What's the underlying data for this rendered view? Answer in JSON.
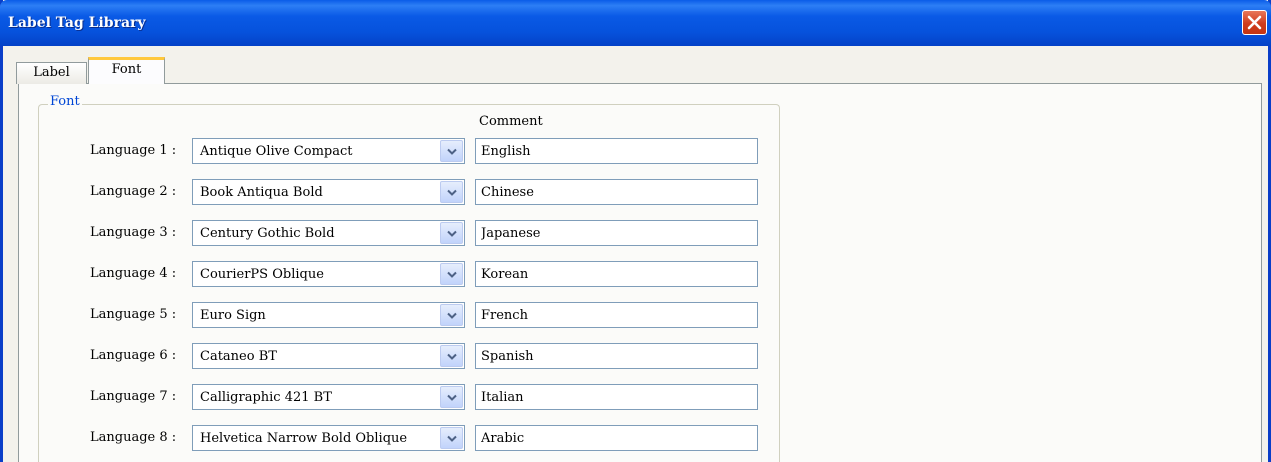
{
  "window": {
    "title": "Label Tag Library",
    "close_icon": "close-icon"
  },
  "tabs": [
    {
      "label": "Label",
      "selected": false
    },
    {
      "label": "Font",
      "selected": true
    }
  ],
  "font_group": {
    "legend": "Font",
    "comment_header": "Comment",
    "rows": [
      {
        "label": "Language 1 :",
        "font": "Antique Olive Compact",
        "comment": "English"
      },
      {
        "label": "Language 2 :",
        "font": "Book Antiqua Bold",
        "comment": "Chinese"
      },
      {
        "label": "Language 3 :",
        "font": "Century Gothic Bold",
        "comment": "Japanese"
      },
      {
        "label": "Language 4 :",
        "font": "CourierPS Oblique",
        "comment": "Korean"
      },
      {
        "label": "Language 5 :",
        "font": "Euro Sign",
        "comment": "French"
      },
      {
        "label": "Language 6 :",
        "font": "Cataneo BT",
        "comment": "Spanish"
      },
      {
        "label": "Language 7 :",
        "font": "Calligraphic 421 BT",
        "comment": "Italian"
      },
      {
        "label": "Language 8 :",
        "font": "Helvetica Narrow Bold Oblique",
        "comment": "Arabic"
      }
    ]
  },
  "colors": {
    "titlebar": "#0652dc",
    "close_button": "#cf3c1e",
    "legend_text": "#0046d5",
    "selected_tab_accent": "#ffc83c"
  }
}
